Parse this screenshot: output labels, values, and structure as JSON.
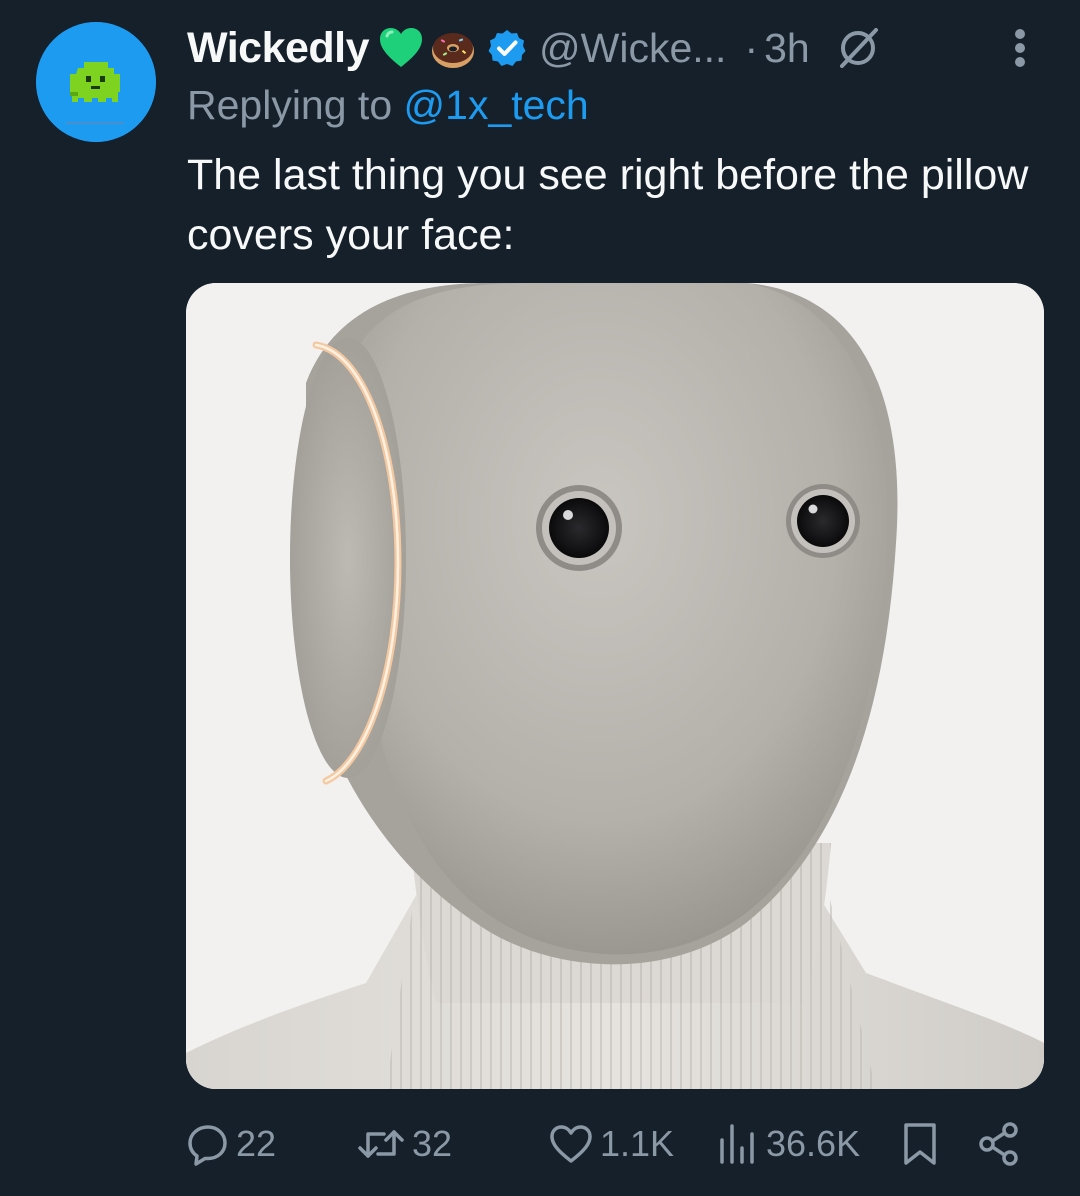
{
  "tweet": {
    "author": {
      "display_name": "Wickedly",
      "handle": "@Wicke...",
      "badges": [
        "green-heart-icon",
        "donut-icon",
        "verified-badge-icon"
      ],
      "avatar": "green-ghost-avatar"
    },
    "time_separator": "·",
    "time": "3h",
    "reply_prefix": "Replying to ",
    "reply_mention": "@1x_tech",
    "text": "The last thing you see right before the pillow covers your face:",
    "media": "robot-head-image",
    "actions": {
      "replies": "22",
      "reposts": "32",
      "likes": "1.1K",
      "views": "36.6K"
    }
  },
  "colors": {
    "background": "#15202b",
    "text_primary": "#f7f9f9",
    "text_secondary": "#8b98a5",
    "accent": "#1d9bf0",
    "avatar_ghost": "#7ed321",
    "badge_heart": "#1fd07a"
  }
}
